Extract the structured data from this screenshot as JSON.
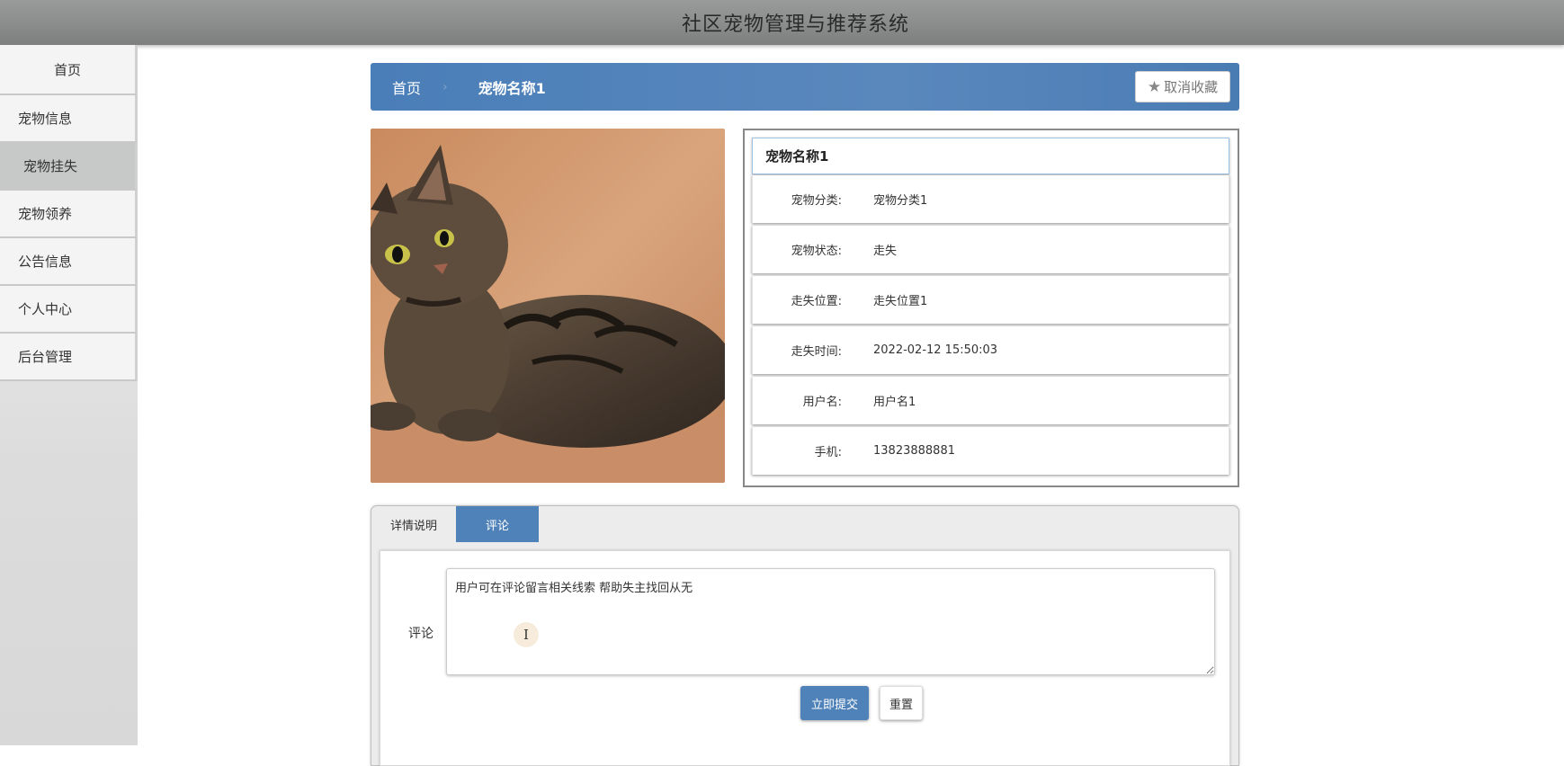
{
  "header": {
    "title": "社区宠物管理与推荐系统"
  },
  "sidebar": {
    "items": [
      {
        "label": "首页"
      },
      {
        "label": "宠物信息"
      },
      {
        "label": "宠物挂失",
        "active": true
      },
      {
        "label": "宠物领养"
      },
      {
        "label": "公告信息"
      },
      {
        "label": "个人中心"
      },
      {
        "label": "后台管理"
      }
    ]
  },
  "breadcrumb": {
    "home": "首页",
    "separator": "›",
    "current": "宠物名称1"
  },
  "favorite": {
    "label": "取消收藏",
    "icon": "star-icon"
  },
  "pet": {
    "name": "宠物名称1",
    "fields": [
      {
        "label": "宠物分类:",
        "value": "宠物分类1"
      },
      {
        "label": "宠物状态:",
        "value": "走失"
      },
      {
        "label": "走失位置:",
        "value": "走失位置1"
      },
      {
        "label": "走失时间:",
        "value": "2022-02-12 15:50:03"
      },
      {
        "label": "用户名:",
        "value": "用户名1"
      },
      {
        "label": "手机:",
        "value": "13823888881"
      }
    ]
  },
  "tabs": [
    {
      "label": "详情说明",
      "active": false
    },
    {
      "label": "评论",
      "active": true
    }
  ],
  "comment_form": {
    "label": "评论",
    "value": "用户可在评论留言相关线索 帮助失主找回从无",
    "submit_label": "立即提交",
    "reset_label": "重置"
  },
  "colors": {
    "accent": "#4f82b9",
    "topbar": "#8c8e8e",
    "sidebar_active": "#c6c9c7"
  }
}
